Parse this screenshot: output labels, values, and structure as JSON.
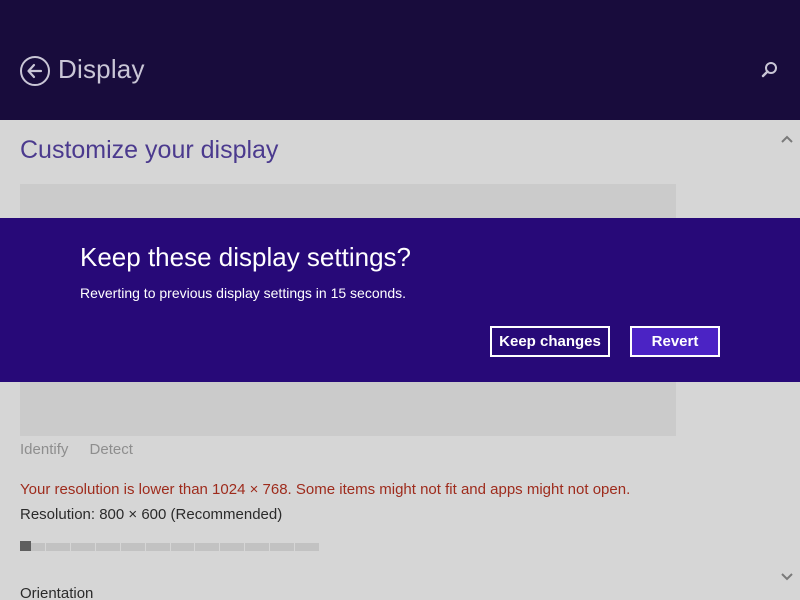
{
  "header": {
    "title": "Display"
  },
  "page": {
    "title": "Customize your display",
    "links": [
      "Identify",
      "Detect"
    ],
    "warning": "Your resolution is lower than 1024 × 768. Some items might not fit and apps might not open.",
    "resolution_label": "Resolution: 800 × 600 (Recommended)",
    "resolution_slider": {
      "steps": 12,
      "selected_index": 0
    },
    "orientation_label": "Orientation"
  },
  "dialog": {
    "title": "Keep these display settings?",
    "message": "Reverting to previous display settings in 15 seconds.",
    "keep_label": "Keep changes",
    "revert_label": "Revert"
  },
  "colors": {
    "header_bg": "#180c3c",
    "dialog_bg": "#270978",
    "accent_button": "#4b23c4",
    "warning_text": "#9e2b1c",
    "title_text": "#4b3a8e"
  },
  "icons": {
    "back": "back-arrow-icon",
    "search": "search-icon",
    "scroll_up": "chevron-up-icon",
    "scroll_down": "chevron-down-icon"
  }
}
